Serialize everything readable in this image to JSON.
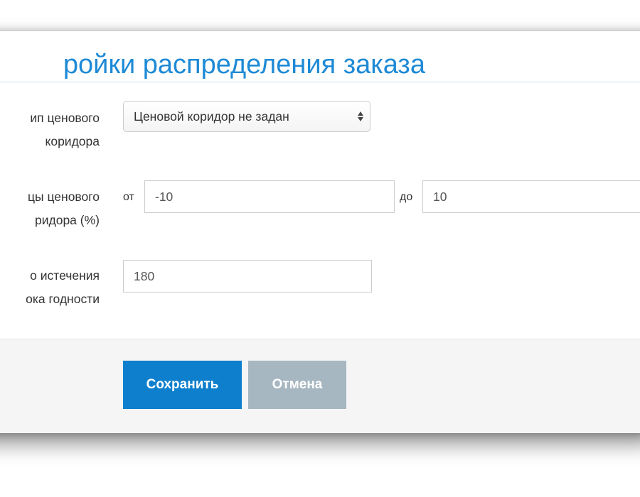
{
  "dialog": {
    "title": "ройки распределения заказа"
  },
  "form": {
    "price_corridor_type": {
      "label_line1": "ип ценового",
      "label_line2": "коридора",
      "selected": "Ценовой коридор не задан"
    },
    "price_corridor_bounds": {
      "label_line1": "цы ценового",
      "label_line2": "ридора (%)",
      "from_label": "от",
      "from_value": "-10",
      "to_label": "до",
      "to_value": "10"
    },
    "expiry": {
      "label_line1": "о истечения",
      "label_line2": "ока годности",
      "value": "180"
    }
  },
  "footer": {
    "save_label": "Сохранить",
    "cancel_label": "Отмена"
  },
  "colors": {
    "title": "#1e8ad6",
    "save_button": "#0e7fcd",
    "cancel_button": "#a7b7c1",
    "footer_bg": "#f5f5f5"
  }
}
